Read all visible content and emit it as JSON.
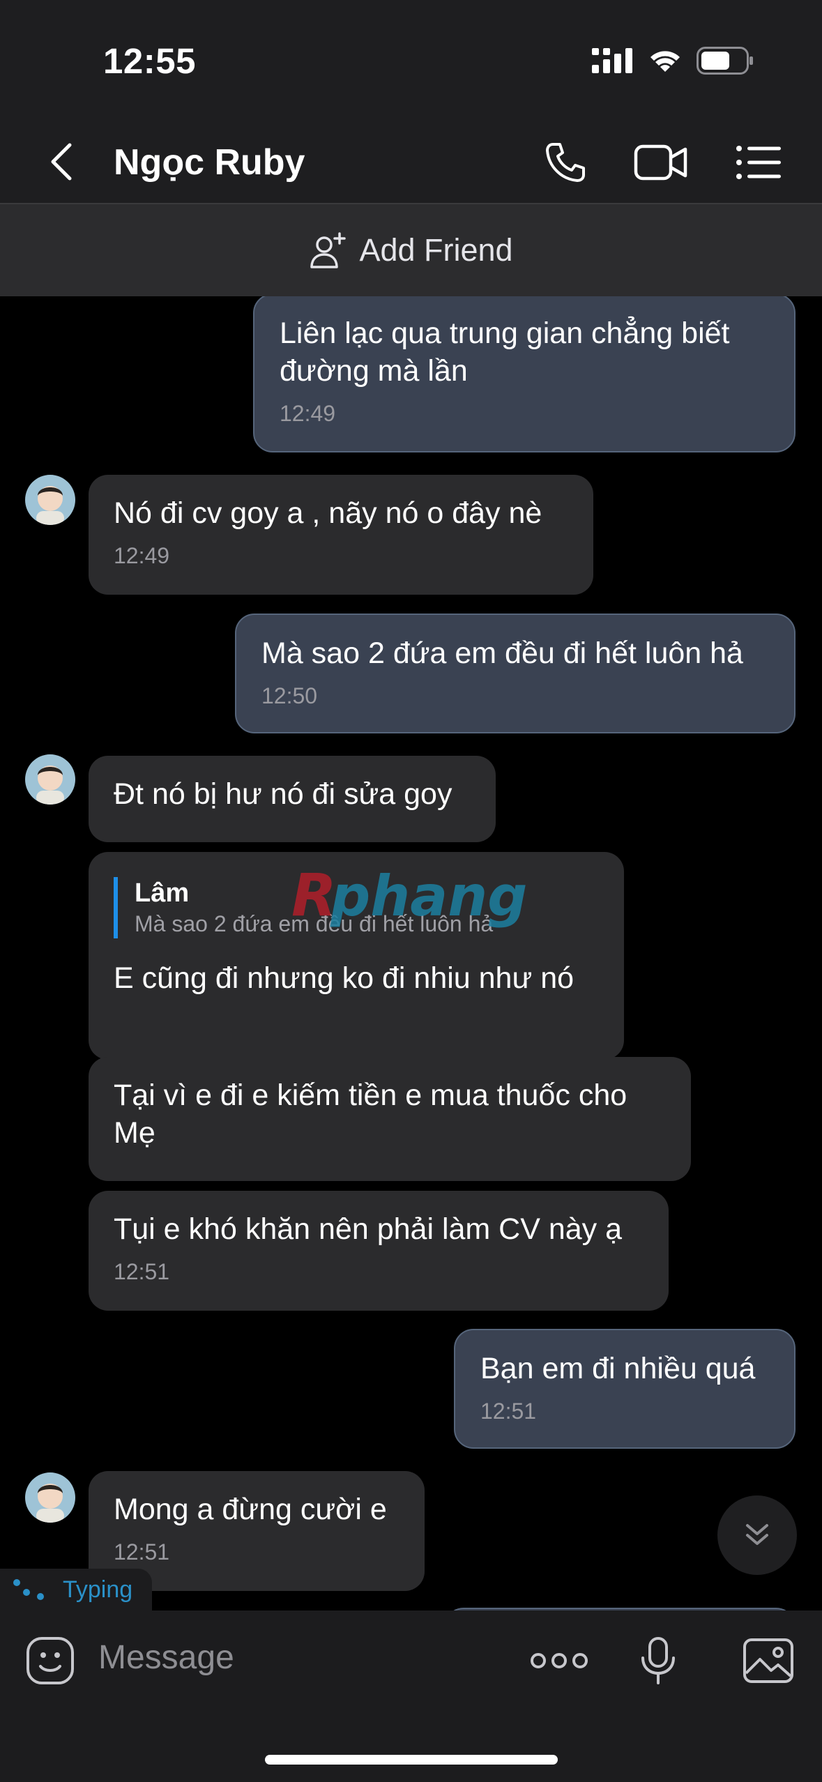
{
  "status_bar": {
    "time": "12:55"
  },
  "header": {
    "contact_name": "Ngọc Ruby"
  },
  "add_friend": {
    "label": "Add Friend"
  },
  "messages": [
    {
      "text": "Liên lạc qua trung gian chẳng biết đường mà lần",
      "time": "12:49"
    },
    {
      "text": "Nó đi cv goy a , nãy nó o đây nè",
      "time": "12:49"
    },
    {
      "text": "Mà sao 2 đứa em đều đi hết luôn hả",
      "time": "12:50"
    },
    {
      "text": "Đt nó bị hư nó đi sửa goy"
    },
    {
      "quote_author": "Lâm",
      "quote_text": "Mà sao 2 đứa em đều đi hết luôn hả",
      "text": "E cũng đi nhưng ko đi nhiu như nó"
    },
    {
      "text": "Tại vì e đi e kiếm tiền e mua thuốc cho Mẹ"
    },
    {
      "text": "Tụi e khó khăn nên phải làm CV này ạ",
      "time": "12:51"
    },
    {
      "text": "Bạn em đi nhiều quá",
      "time": "12:51"
    },
    {
      "text": "Mong a đừng cười e",
      "time": "12:51"
    }
  ],
  "watermark": {
    "text": "Rphang"
  },
  "typing": {
    "label": "Typing"
  },
  "input": {
    "placeholder": "Message"
  },
  "colors": {
    "accent": "#1e8fe8",
    "outgoing_bubble": "#3a4252",
    "incoming_bubble": "#2b2b2d",
    "header_bg": "#1e1e20"
  }
}
